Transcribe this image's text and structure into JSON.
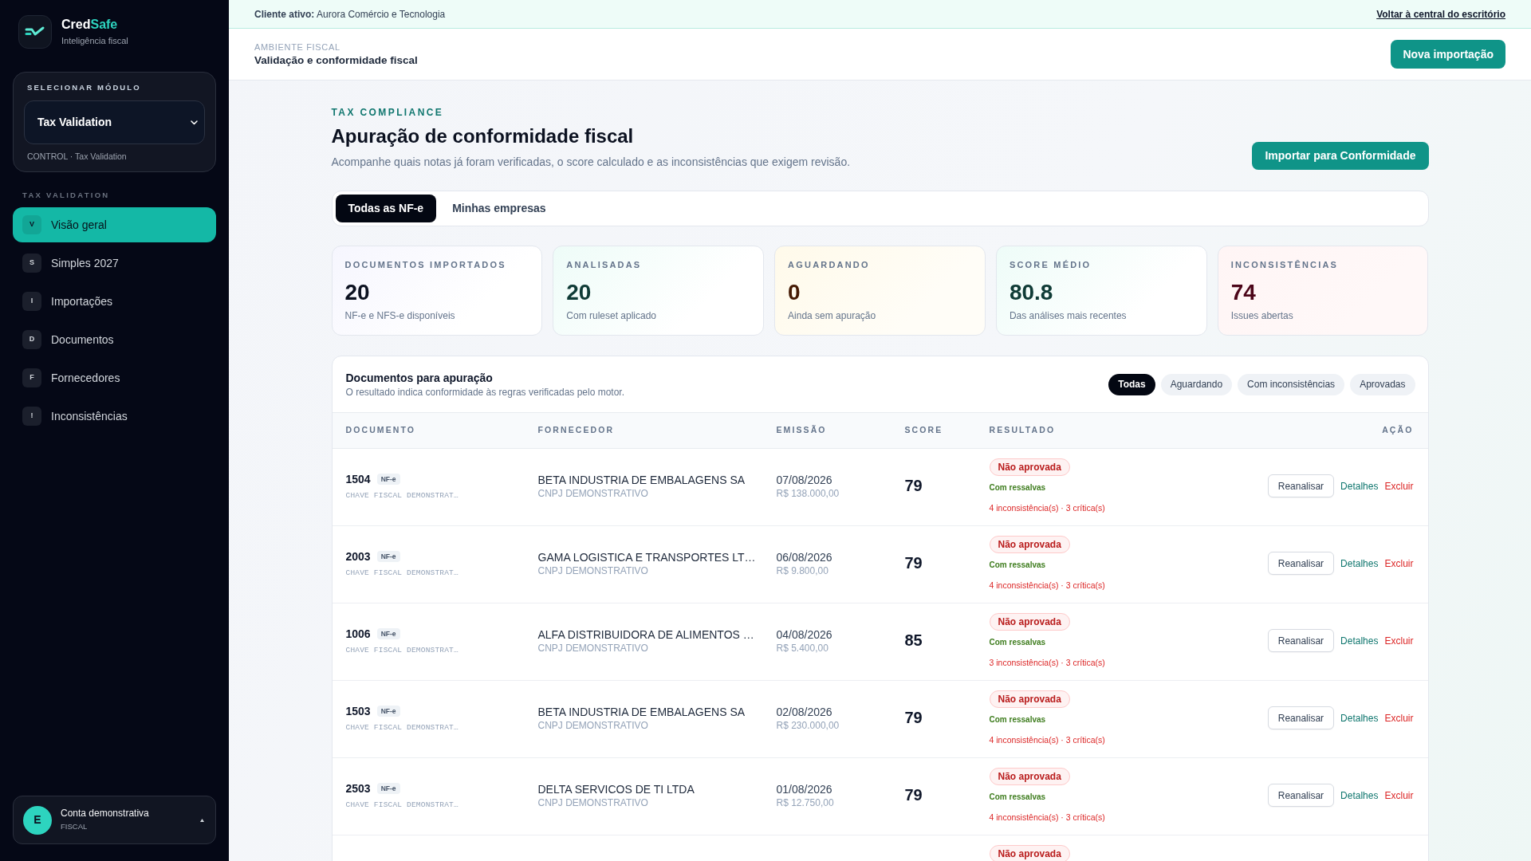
{
  "sidebar": {
    "brand": {
      "name": "Cred",
      "name_accent": "Safe",
      "tagline": "Inteligência fiscal"
    },
    "module_selector": {
      "label": "SELECIONAR MÓDULO",
      "value": "Tax Validation",
      "caption": "CONTROL · Tax Validation"
    },
    "nav": {
      "section": "TAX VALIDATION",
      "items": [
        {
          "initial": "V",
          "label": "Visão geral",
          "selected": true
        },
        {
          "initial": "S",
          "label": "Simples 2027",
          "selected": false
        },
        {
          "initial": "I",
          "label": "Importações",
          "selected": false
        },
        {
          "initial": "D",
          "label": "Documentos",
          "selected": false
        },
        {
          "initial": "F",
          "label": "Fornecedores",
          "selected": false
        },
        {
          "initial": "!",
          "label": "Inconsistências",
          "selected": false
        }
      ]
    },
    "account": {
      "initial": "E",
      "name": "Conta demonstrativa",
      "role": "FISCAL"
    }
  },
  "client_banner": {
    "text": "**Cliente ativo:** Aurora Comércio e Tecnologia",
    "link": "Voltar à central do escritório"
  },
  "header": {
    "eyebrow": "AMBIENTE FISCAL",
    "title": "Validação e conformidade fiscal",
    "button": "Nova importação"
  },
  "intro": {
    "eyebrow": "TAX COMPLIANCE",
    "title": "Apuração de conformidade fiscal",
    "subtitle": "Acompanhe quais notas já foram verificadas, o score calculado e as inconsistências que exigem revisão.",
    "button": "Importar para Conformidade"
  },
  "scope_tabs": [
    {
      "label": "Todas as NF-e",
      "selected": true
    },
    {
      "label": "Minhas empresas",
      "selected": false
    }
  ],
  "stats": [
    {
      "kind": "neutral",
      "label": "DOCUMENTOS IMPORTADOS",
      "value": "20",
      "caption": "NF-e e NFS-e disponíveis"
    },
    {
      "kind": "positive",
      "label": "ANALISADAS",
      "value": "20",
      "caption": "Com ruleset aplicado"
    },
    {
      "kind": "warning",
      "label": "AGUARDANDO",
      "value": "0",
      "caption": "Ainda sem apuração"
    },
    {
      "kind": "positive",
      "label": "SCORE MÉDIO",
      "value": "80.8",
      "caption": "Das análises mais recentes"
    },
    {
      "kind": "negative",
      "label": "INCONSISTÊNCIAS",
      "value": "74",
      "caption": "Issues abertas"
    }
  ],
  "documents": {
    "title": "Documentos para apuração",
    "subtitle": "O resultado indica conformidade às regras verificadas pelo motor.",
    "filters": [
      {
        "label": "Todas",
        "selected": true
      },
      {
        "label": "Aguardando",
        "selected": false
      },
      {
        "label": "Com inconsistências",
        "selected": false
      },
      {
        "label": "Aprovadas",
        "selected": false
      }
    ],
    "columns": [
      "DOCUMENTO",
      "FORNECEDOR",
      "EMISSÃO",
      "SCORE",
      "RESULTADO",
      "AÇÃO"
    ],
    "rows": [
      {
        "number": "1504",
        "type": "NF-e",
        "key": "CHAVE FISCAL DEMONSTRAT…",
        "supplier": "BETA INDUSTRIA DE EMBALAGENS SA",
        "supplier_id": "CNPJ DEMONSTRATIVO",
        "date": "07/08/2026",
        "amount": "R$ 138.000,00",
        "score": "79",
        "result": {
          "kind": "rejected",
          "label": "Não aprovada"
        },
        "note": "Com ressalvas",
        "issues": "4 inconsistência(s) · 3 crítica(s)",
        "actions": {
          "reanalyze": "Reanalisar",
          "details": "Detalhes",
          "delete": "Excluir"
        }
      },
      {
        "number": "2003",
        "type": "NF-e",
        "key": "CHAVE FISCAL DEMONSTRAT…",
        "supplier": "GAMA LOGISTICA E TRANSPORTES LT…",
        "supplier_id": "CNPJ DEMONSTRATIVO",
        "date": "06/08/2026",
        "amount": "R$ 9.800,00",
        "score": "79",
        "result": {
          "kind": "rejected",
          "label": "Não aprovada"
        },
        "note": "Com ressalvas",
        "issues": "4 inconsistência(s) · 3 crítica(s)",
        "actions": {
          "reanalyze": "Reanalisar",
          "details": "Detalhes",
          "delete": "Excluir"
        }
      },
      {
        "number": "1006",
        "type": "NF-e",
        "key": "CHAVE FISCAL DEMONSTRAT…",
        "supplier": "ALFA DISTRIBUIDORA DE ALIMENTOS …",
        "supplier_id": "CNPJ DEMONSTRATIVO",
        "date": "04/08/2026",
        "amount": "R$ 5.400,00",
        "score": "85",
        "result": {
          "kind": "rejected",
          "label": "Não aprovada"
        },
        "note": "Com ressalvas",
        "issues": "3 inconsistência(s) · 3 crítica(s)",
        "actions": {
          "reanalyze": "Reanalisar",
          "details": "Detalhes",
          "delete": "Excluir"
        }
      },
      {
        "number": "1503",
        "type": "NF-e",
        "key": "CHAVE FISCAL DEMONSTRAT…",
        "supplier": "BETA INDUSTRIA DE EMBALAGENS SA",
        "supplier_id": "CNPJ DEMONSTRATIVO",
        "date": "02/08/2026",
        "amount": "R$ 230.000,00",
        "score": "79",
        "result": {
          "kind": "rejected",
          "label": "Não aprovada"
        },
        "note": "Com ressalvas",
        "issues": "4 inconsistência(s) · 3 crítica(s)",
        "actions": {
          "reanalyze": "Reanalisar",
          "details": "Detalhes",
          "delete": "Excluir"
        }
      },
      {
        "number": "2503",
        "type": "NF-e",
        "key": "CHAVE FISCAL DEMONSTRAT…",
        "supplier": "DELTA SERVICOS DE TI LTDA",
        "supplier_id": "CNPJ DEMONSTRATIVO",
        "date": "01/08/2026",
        "amount": "R$ 12.750,00",
        "score": "79",
        "result": {
          "kind": "rejected",
          "label": "Não aprovada"
        },
        "note": "Com ressalvas",
        "issues": "4 inconsistência(s) · 3 crítica(s)",
        "actions": {
          "reanalyze": "Reanalisar",
          "details": "Detalhes",
          "delete": "Excluir"
        }
      },
      {
        "result": {
          "kind": "rejected",
          "label": "Não aprovada"
        }
      }
    ]
  }
}
